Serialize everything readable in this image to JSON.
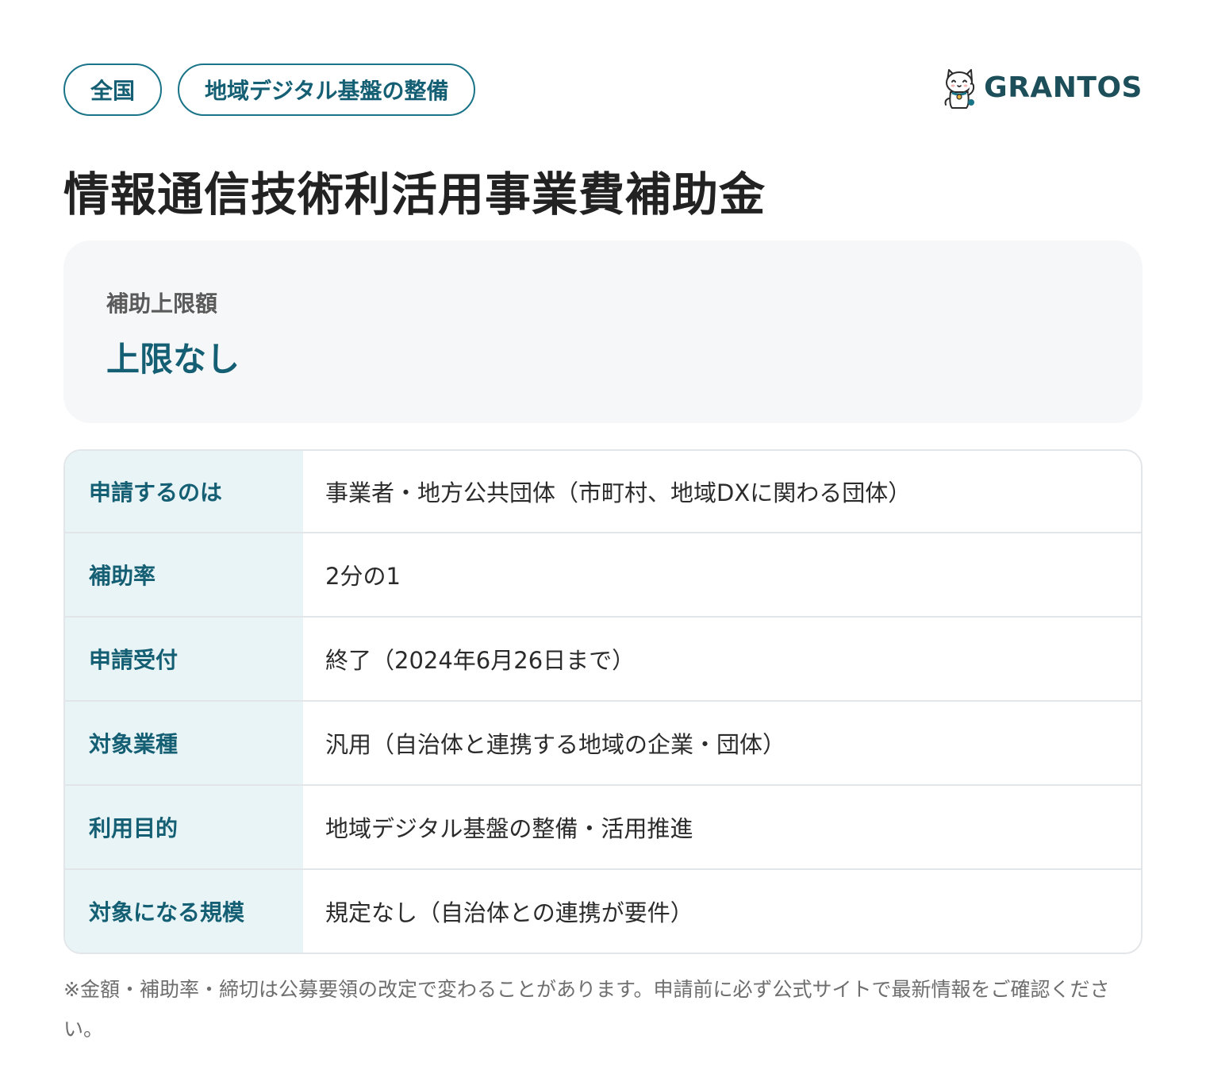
{
  "tags": [
    "全国",
    "地域デジタル基盤の整備"
  ],
  "logo": {
    "text": "GRANTOS",
    "icon": "maneki-neko-cat-icon"
  },
  "title": "情報通信技術利活用事業費補助金",
  "limit": {
    "label": "補助上限額",
    "value": "上限なし"
  },
  "rows": [
    {
      "label": "申請するのは",
      "value": "事業者・地方公共団体（市町村、地域DXに関わる団体）"
    },
    {
      "label": "補助率",
      "value": "2分の1"
    },
    {
      "label": "申請受付",
      "value": "終了（2024年6月26日まで）"
    },
    {
      "label": "対象業種",
      "value": "汎用（自治体と連携する地域の企業・団体）"
    },
    {
      "label": "利用目的",
      "value": "地域デジタル基盤の整備・活用推進"
    },
    {
      "label": "対象になる規模",
      "value": "規定なし（自治体との連携が要件）"
    }
  ],
  "note": "※金額・補助率・締切は公募要領の改定で変わることがあります。申請前に必ず公式サイトで最新情報をご確認ください。",
  "colors": {
    "accent": "#145f73",
    "tag_border": "#1a7488",
    "header_cell_bg": "#e9f4f6",
    "limit_box_bg": "#f5f7f9"
  }
}
